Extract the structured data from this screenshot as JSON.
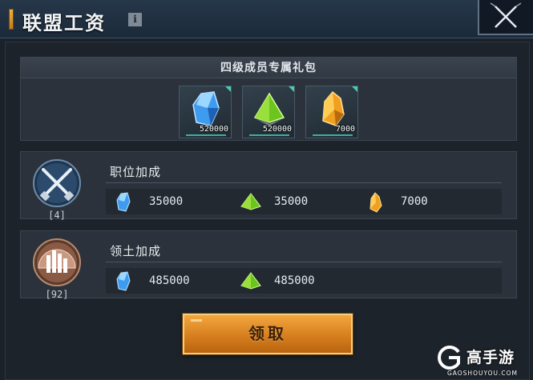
{
  "window": {
    "title": "联盟工资",
    "info_icon": "info-icon",
    "close_icon": "close-x-icon"
  },
  "gift_pack": {
    "title": "四级成员专属礼包",
    "rewards": [
      {
        "icon": "blue-crystal-icon",
        "qty": "520000"
      },
      {
        "icon": "green-pyramid-icon",
        "qty": "520000"
      },
      {
        "icon": "orange-crystal-icon",
        "qty": "7000"
      }
    ]
  },
  "position_bonus": {
    "title": "职位加成",
    "emblem_icon": "crossed-guns-icon",
    "level": "[4]",
    "values": [
      {
        "icon": "blue-crystal-icon",
        "value": "35000"
      },
      {
        "icon": "green-pyramid-icon",
        "value": "35000"
      },
      {
        "icon": "orange-crystal-icon",
        "value": "7000"
      }
    ]
  },
  "territory_bonus": {
    "title": "领土加成",
    "emblem_icon": "dome-city-icon",
    "level": "[92]",
    "values": [
      {
        "icon": "blue-crystal-icon",
        "value": "485000"
      },
      {
        "icon": "green-pyramid-icon",
        "value": "485000"
      }
    ]
  },
  "claim_button": {
    "label": "领取"
  },
  "watermark": {
    "brand": "高手游",
    "url": "GAOSHOUYOU.COM"
  },
  "colors": {
    "accent_gold": "#f0b040",
    "button_orange": "#d77f1f",
    "crystal_blue": "#4fb4ff",
    "pyramid_green": "#7bd12a",
    "crystal_orange": "#f0a020",
    "teal_marker": "#4cc9b2"
  }
}
